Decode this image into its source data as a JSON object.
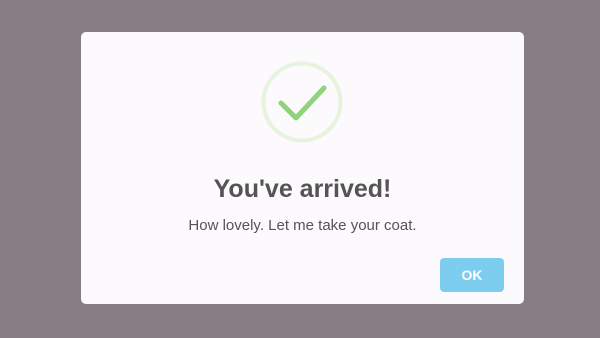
{
  "dialog": {
    "icon": "success-check-icon",
    "title": "You've arrived!",
    "message": "How lovely. Let me take your coat.",
    "confirm_label": "OK"
  },
  "colors": {
    "backdrop": "#877e83",
    "dialog_background": "#fcfafc",
    "success_ring": "#e6f3dd",
    "success_check": "#8fd37c",
    "text": "#545454",
    "confirm_button": "#7ccdf0",
    "confirm_text": "#ffffff"
  }
}
